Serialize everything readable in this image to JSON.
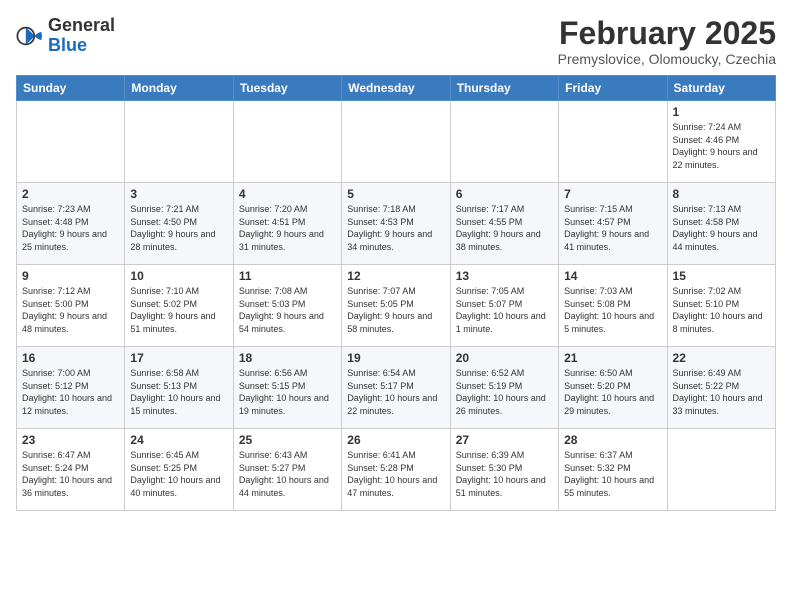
{
  "header": {
    "logo_general": "General",
    "logo_blue": "Blue",
    "month_year": "February 2025",
    "location": "Premyslovice, Olomoucky, Czechia"
  },
  "weekdays": [
    "Sunday",
    "Monday",
    "Tuesday",
    "Wednesday",
    "Thursday",
    "Friday",
    "Saturday"
  ],
  "weeks": [
    [
      {
        "day": "",
        "info": ""
      },
      {
        "day": "",
        "info": ""
      },
      {
        "day": "",
        "info": ""
      },
      {
        "day": "",
        "info": ""
      },
      {
        "day": "",
        "info": ""
      },
      {
        "day": "",
        "info": ""
      },
      {
        "day": "1",
        "info": "Sunrise: 7:24 AM\nSunset: 4:46 PM\nDaylight: 9 hours and 22 minutes."
      }
    ],
    [
      {
        "day": "2",
        "info": "Sunrise: 7:23 AM\nSunset: 4:48 PM\nDaylight: 9 hours and 25 minutes."
      },
      {
        "day": "3",
        "info": "Sunrise: 7:21 AM\nSunset: 4:50 PM\nDaylight: 9 hours and 28 minutes."
      },
      {
        "day": "4",
        "info": "Sunrise: 7:20 AM\nSunset: 4:51 PM\nDaylight: 9 hours and 31 minutes."
      },
      {
        "day": "5",
        "info": "Sunrise: 7:18 AM\nSunset: 4:53 PM\nDaylight: 9 hours and 34 minutes."
      },
      {
        "day": "6",
        "info": "Sunrise: 7:17 AM\nSunset: 4:55 PM\nDaylight: 9 hours and 38 minutes."
      },
      {
        "day": "7",
        "info": "Sunrise: 7:15 AM\nSunset: 4:57 PM\nDaylight: 9 hours and 41 minutes."
      },
      {
        "day": "8",
        "info": "Sunrise: 7:13 AM\nSunset: 4:58 PM\nDaylight: 9 hours and 44 minutes."
      }
    ],
    [
      {
        "day": "9",
        "info": "Sunrise: 7:12 AM\nSunset: 5:00 PM\nDaylight: 9 hours and 48 minutes."
      },
      {
        "day": "10",
        "info": "Sunrise: 7:10 AM\nSunset: 5:02 PM\nDaylight: 9 hours and 51 minutes."
      },
      {
        "day": "11",
        "info": "Sunrise: 7:08 AM\nSunset: 5:03 PM\nDaylight: 9 hours and 54 minutes."
      },
      {
        "day": "12",
        "info": "Sunrise: 7:07 AM\nSunset: 5:05 PM\nDaylight: 9 hours and 58 minutes."
      },
      {
        "day": "13",
        "info": "Sunrise: 7:05 AM\nSunset: 5:07 PM\nDaylight: 10 hours and 1 minute."
      },
      {
        "day": "14",
        "info": "Sunrise: 7:03 AM\nSunset: 5:08 PM\nDaylight: 10 hours and 5 minutes."
      },
      {
        "day": "15",
        "info": "Sunrise: 7:02 AM\nSunset: 5:10 PM\nDaylight: 10 hours and 8 minutes."
      }
    ],
    [
      {
        "day": "16",
        "info": "Sunrise: 7:00 AM\nSunset: 5:12 PM\nDaylight: 10 hours and 12 minutes."
      },
      {
        "day": "17",
        "info": "Sunrise: 6:58 AM\nSunset: 5:13 PM\nDaylight: 10 hours and 15 minutes."
      },
      {
        "day": "18",
        "info": "Sunrise: 6:56 AM\nSunset: 5:15 PM\nDaylight: 10 hours and 19 minutes."
      },
      {
        "day": "19",
        "info": "Sunrise: 6:54 AM\nSunset: 5:17 PM\nDaylight: 10 hours and 22 minutes."
      },
      {
        "day": "20",
        "info": "Sunrise: 6:52 AM\nSunset: 5:19 PM\nDaylight: 10 hours and 26 minutes."
      },
      {
        "day": "21",
        "info": "Sunrise: 6:50 AM\nSunset: 5:20 PM\nDaylight: 10 hours and 29 minutes."
      },
      {
        "day": "22",
        "info": "Sunrise: 6:49 AM\nSunset: 5:22 PM\nDaylight: 10 hours and 33 minutes."
      }
    ],
    [
      {
        "day": "23",
        "info": "Sunrise: 6:47 AM\nSunset: 5:24 PM\nDaylight: 10 hours and 36 minutes."
      },
      {
        "day": "24",
        "info": "Sunrise: 6:45 AM\nSunset: 5:25 PM\nDaylight: 10 hours and 40 minutes."
      },
      {
        "day": "25",
        "info": "Sunrise: 6:43 AM\nSunset: 5:27 PM\nDaylight: 10 hours and 44 minutes."
      },
      {
        "day": "26",
        "info": "Sunrise: 6:41 AM\nSunset: 5:28 PM\nDaylight: 10 hours and 47 minutes."
      },
      {
        "day": "27",
        "info": "Sunrise: 6:39 AM\nSunset: 5:30 PM\nDaylight: 10 hours and 51 minutes."
      },
      {
        "day": "28",
        "info": "Sunrise: 6:37 AM\nSunset: 5:32 PM\nDaylight: 10 hours and 55 minutes."
      },
      {
        "day": "",
        "info": ""
      }
    ]
  ]
}
